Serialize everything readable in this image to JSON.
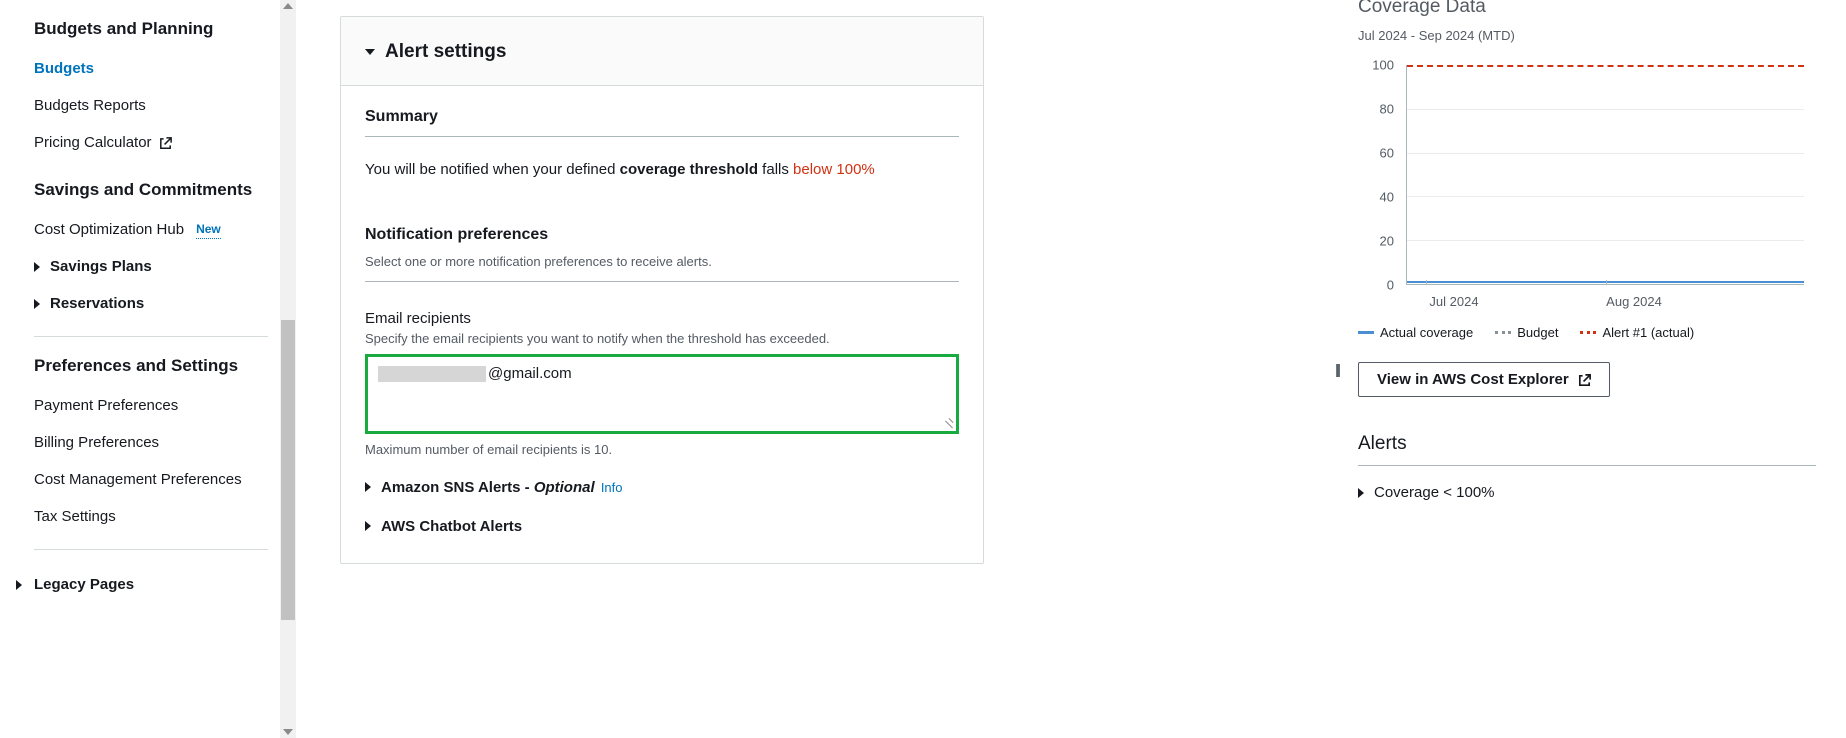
{
  "sidebar": {
    "section_budgets": "Budgets and Planning",
    "items_budgets": [
      {
        "label": "Budgets",
        "active": true
      },
      {
        "label": "Budgets Reports"
      },
      {
        "label": "Pricing Calculator",
        "external": true
      }
    ],
    "section_savings": "Savings and Commitments",
    "cost_opt": {
      "label": "Cost Optimization Hub",
      "badge": "New"
    },
    "expanders": [
      {
        "label": "Savings Plans"
      },
      {
        "label": "Reservations"
      }
    ],
    "section_prefs": "Preferences and Settings",
    "items_prefs": [
      {
        "label": "Payment Preferences"
      },
      {
        "label": "Billing Preferences"
      },
      {
        "label": "Cost Management Preferences"
      },
      {
        "label": "Tax Settings"
      }
    ],
    "legacy": "Legacy Pages"
  },
  "panel": {
    "title": "Alert settings",
    "summary_heading": "Summary",
    "summary": {
      "prefix": "You will be notified when your defined ",
      "bold": "coverage threshold",
      "mid": " falls ",
      "value": "below 100%"
    },
    "notif_heading": "Notification preferences",
    "notif_desc": "Select one or more notification preferences to receive alerts.",
    "email": {
      "label": "Email recipients",
      "help": "Specify the email recipients you want to notify when the threshold has exceeded.",
      "value_suffix": "@gmail.com",
      "foot": "Maximum number of email recipients is 10."
    },
    "sns": {
      "label": "Amazon SNS Alerts - ",
      "optional": "Optional",
      "info": "Info"
    },
    "chatbot": {
      "label": "AWS Chatbot Alerts"
    }
  },
  "right": {
    "title": "Coverage Data",
    "subtitle": "Jul 2024 - Sep 2024 (MTD)",
    "legend": {
      "actual": "Actual coverage",
      "budget": "Budget",
      "alert": "Alert #1 (actual)"
    },
    "view_btn": "View in AWS Cost Explorer",
    "alerts_heading": "Alerts",
    "alert_row": "Coverage < 100%"
  },
  "chart_data": {
    "type": "line",
    "title": "Coverage Data",
    "xlabel": "",
    "ylabel": "",
    "ylim": [
      0,
      100
    ],
    "y_ticks": [
      0,
      20,
      40,
      60,
      80,
      100
    ],
    "x_ticks": [
      "Jul 2024",
      "Aug 2024"
    ],
    "series": [
      {
        "name": "Actual coverage",
        "style": "solid-blue",
        "values": [
          1,
          1
        ]
      },
      {
        "name": "Budget",
        "style": "dot-grey",
        "values": [
          null,
          null
        ]
      },
      {
        "name": "Alert #1 (actual)",
        "style": "dashed-red",
        "threshold": 100
      }
    ]
  },
  "collapse_glyph": "||"
}
